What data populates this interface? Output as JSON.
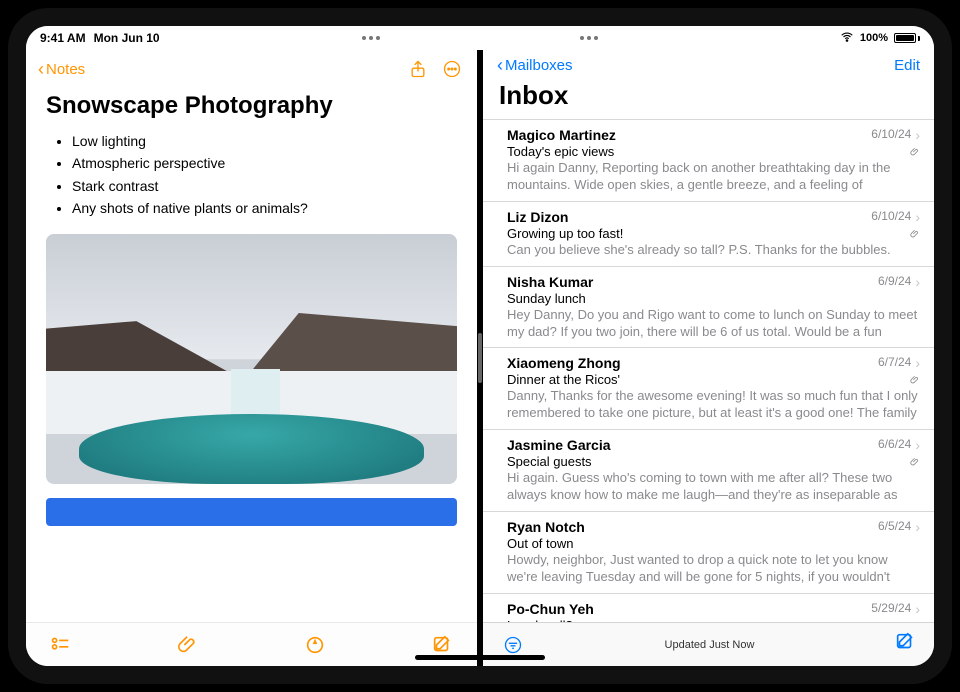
{
  "statusbar": {
    "time": "9:41 AM",
    "date": "Mon Jun 10",
    "battery_pct": "100%"
  },
  "notes": {
    "back_label": "Notes",
    "title": "Snowscape Photography",
    "bullets": [
      "Low lighting",
      "Atmospheric perspective",
      "Stark contrast",
      "Any shots of native plants or animals?"
    ]
  },
  "mail": {
    "back_label": "Mailboxes",
    "edit_label": "Edit",
    "title": "Inbox",
    "status": "Updated Just Now",
    "messages": [
      {
        "sender": "Magico Martinez",
        "date": "6/10/24",
        "subject": "Today's epic views",
        "preview": "Hi again Danny, Reporting back on another breathtaking day in the mountains. Wide open skies, a gentle breeze, and a feeling of adventure in the air. I felt l…",
        "attachment": true
      },
      {
        "sender": "Liz Dizon",
        "date": "6/10/24",
        "subject": "Growing up too fast!",
        "preview": "Can you believe she's already so tall? P.S. Thanks for the bubbles.",
        "attachment": true
      },
      {
        "sender": "Nisha Kumar",
        "date": "6/9/24",
        "subject": "Sunday lunch",
        "preview": "Hey Danny, Do you and Rigo want to come to lunch on Sunday to meet my dad? If you two join, there will be 6 of us total. Would be a fun group. Even if…",
        "attachment": false
      },
      {
        "sender": "Xiaomeng Zhong",
        "date": "6/7/24",
        "subject": "Dinner at the Ricos'",
        "preview": "Danny, Thanks for the awesome evening! It was so much fun that I only remembered to take one picture, but at least it's a good one! The family and…",
        "attachment": true
      },
      {
        "sender": "Jasmine Garcia",
        "date": "6/6/24",
        "subject": "Special guests",
        "preview": "Hi again. Guess who's coming to town with me after all? These two always know how to make me laugh—and they're as inseparable as ever. #goals",
        "attachment": true
      },
      {
        "sender": "Ryan Notch",
        "date": "6/5/24",
        "subject": "Out of town",
        "preview": "Howdy, neighbor, Just wanted to drop a quick note to let you know we're leaving Tuesday and will be gone for 5 nights, if you wouldn't mind keeping…",
        "attachment": false
      },
      {
        "sender": "Po-Chun Yeh",
        "date": "5/29/24",
        "subject": "Lunch call?",
        "preview": "",
        "attachment": false
      }
    ]
  }
}
